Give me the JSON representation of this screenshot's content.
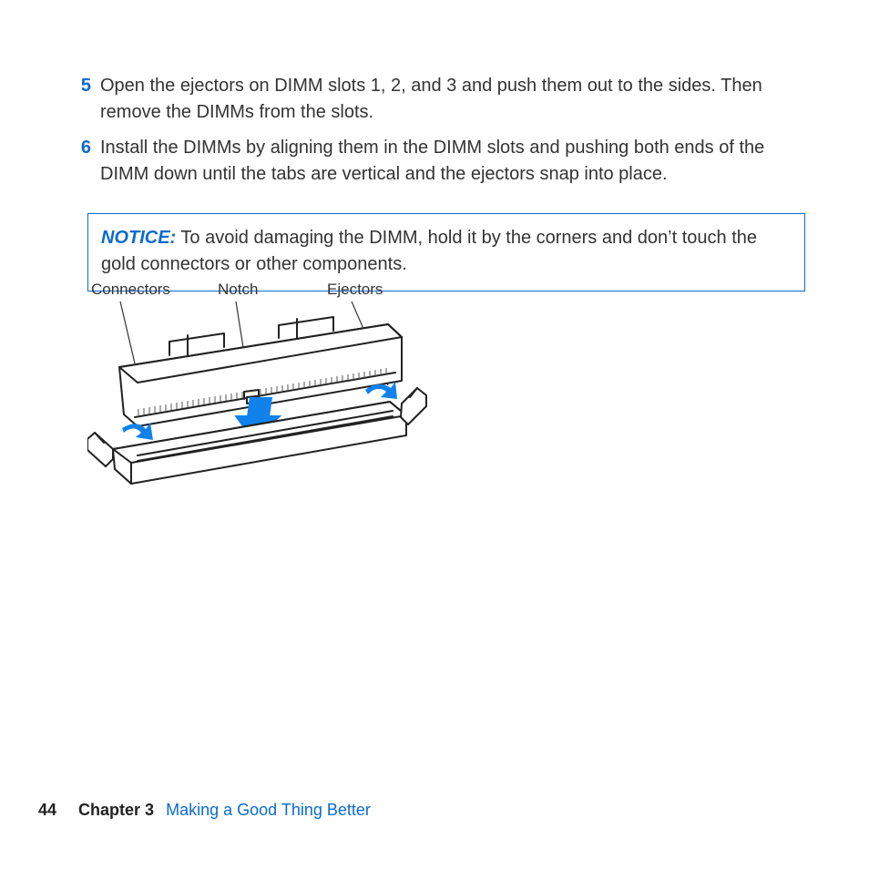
{
  "steps": [
    {
      "num": "5",
      "text": "Open the ejectors on DIMM slots 1, 2, and 3 and push them out to the sides. Then remove the DIMMs from the slots."
    },
    {
      "num": "6",
      "text": "Install the DIMMs by aligning them in the DIMM slots and pushing both ends of the DIMM down until the tabs are vertical and the ejectors snap into place."
    }
  ],
  "notice": {
    "label": "NOTICE:",
    "text": "  To avoid damaging the DIMM, hold it by the corners and don’t touch the gold connectors or other components."
  },
  "figure": {
    "labels": {
      "connectors": "Connectors",
      "notch": "Notch",
      "ejectors": "Ejectors"
    }
  },
  "footer": {
    "page": "44",
    "chapter_label": "Chapter 3",
    "chapter_title": "Making a Good Thing Better"
  }
}
